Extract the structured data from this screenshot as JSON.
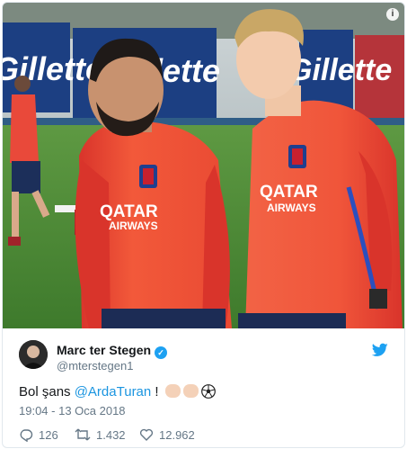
{
  "tweet": {
    "author_name": "Marc ter Stegen",
    "author_handle": "@mterstegen1",
    "text_prefix": "Bol şans ",
    "mention": "@ArdaTuran",
    "text_suffix": " ! ",
    "timestamp": "19:04 - 13 Oca 2018",
    "replies": "126",
    "retweets": "1.432",
    "likes": "12.962"
  },
  "photo": {
    "banner_text": "Gillette",
    "shirt_text_1": "QATAR",
    "shirt_text_2": "AIRWAYS"
  },
  "colors": {
    "shirt_orange": "#f2593a",
    "shirt_red": "#d9342b",
    "pitch_green": "#4f8a37",
    "banner_blue": "#1c3f82",
    "twitter_blue": "#1da1f2"
  },
  "icons": [
    "info-icon",
    "verified-icon",
    "twitter-bird-icon",
    "reply-icon",
    "retweet-icon",
    "like-icon",
    "flexed-biceps-emoji",
    "fist-emoji",
    "soccer-ball-emoji"
  ]
}
